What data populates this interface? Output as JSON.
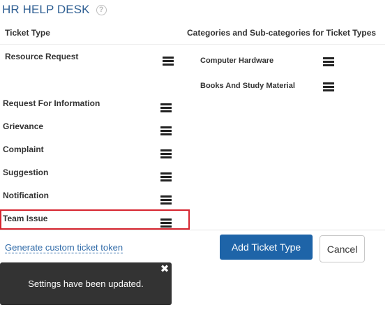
{
  "header": {
    "title": "HR HELP DESK",
    "help_icon": "question-circle-icon",
    "help_glyph": "?"
  },
  "columns": {
    "ticket_type": "Ticket Type",
    "categories": "Categories and Sub-categories for Ticket Types"
  },
  "ticket_types": [
    "Resource Request",
    "Request For Information",
    "Grievance",
    "Complaint",
    "Suggestion",
    "Notification",
    "Team Issue"
  ],
  "categories": [
    "Computer Hardware",
    "Books And Study Material"
  ],
  "actions": {
    "generate_token": "Generate custom ticket token",
    "add_ticket_type": "Add Ticket Type",
    "cancel": "Cancel"
  },
  "toast": {
    "message": "Settings have been updated.",
    "close_glyph": "✖"
  },
  "drag_handle_icon": "drag-handle-icon",
  "highlighted_item": "Team Issue",
  "colors": {
    "title": "#2f5f93",
    "primary_button": "#1e64a8",
    "highlight_border": "#d6252f",
    "toast_background": "#333333",
    "link": "#2f6aa8"
  }
}
